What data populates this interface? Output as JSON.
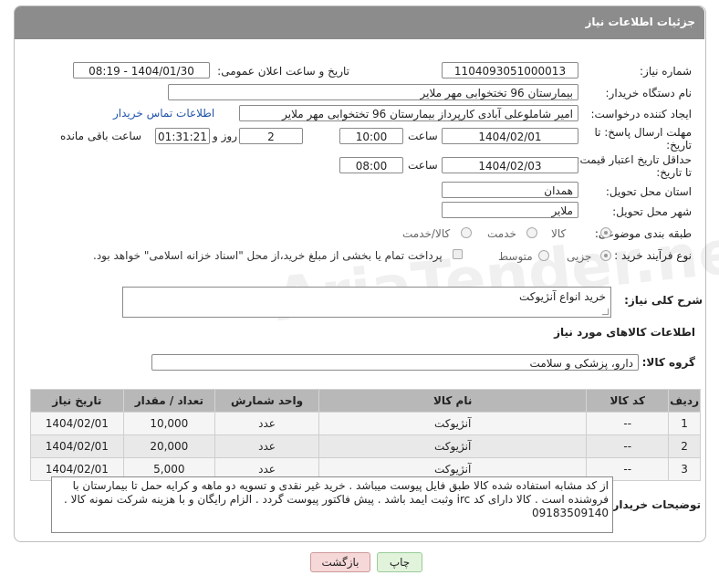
{
  "header": {
    "title": "جزئیات اطلاعات نیاز"
  },
  "form": {
    "need_number": {
      "label": "شماره نیاز:",
      "value": "1104093051000013"
    },
    "announce": {
      "label": "تاریخ و ساعت اعلان عمومی:",
      "value": "1404/01/30 - 08:19"
    },
    "buyer_org": {
      "label": "نام دستگاه خریدار:",
      "value": "بیمارستان 96 تختخوابی مهر ملایر"
    },
    "requester": {
      "label": "ایجاد کننده درخواست:",
      "value": "امیر شاملوعلی آبادی کارپرداز بیمارستان 96 تختخوابی مهر ملایر",
      "contact_link": "اطلاعات تماس خریدار"
    },
    "reply_deadline": {
      "label_line1": "مهلت ارسال پاسخ: تا",
      "label_line2": "تاریخ:",
      "date": "1404/02/01",
      "time_label": "ساعت",
      "time": "10:00",
      "days": "2",
      "days_label": "روز و",
      "remaining": "01:31:21",
      "remaining_label": "ساعت باقی مانده"
    },
    "price_validity": {
      "label_line1": "حداقل تاریخ اعتبار قیمت:",
      "label_line2": "تا تاریخ:",
      "date": "1404/02/03",
      "time_label": "ساعت",
      "time": "08:00"
    },
    "province": {
      "label": "استان محل تحویل:",
      "value": "همدان"
    },
    "city": {
      "label": "شهر محل تحویل:",
      "value": "ملایر"
    },
    "category": {
      "label": "طبقه بندی موضوعی:",
      "options": [
        "کالا",
        "خدمت",
        "کالا/خدمت"
      ],
      "selected": "کالا"
    },
    "process": {
      "label": "نوع فرآیند خرید :",
      "options": [
        "جزیی",
        "متوسط"
      ],
      "payment_note": "پرداخت تمام یا بخشی از مبلغ خرید،از محل \"اسناد خزانه اسلامی\" خواهد بود."
    }
  },
  "summary": {
    "label": "شرح کلی نیاز:",
    "value": "خرید انواع آنژیوکت"
  },
  "goods_section": {
    "title": "اطلاعات کالاهای مورد نیاز"
  },
  "goods_group": {
    "label": "گروه کالا:",
    "value": "دارو، پزشکی و سلامت"
  },
  "table": {
    "headers": [
      "ردیف",
      "کد کالا",
      "نام کالا",
      "واحد شمارش",
      "تعداد / مقدار",
      "تاریخ نیاز"
    ],
    "rows": [
      [
        "1",
        "--",
        "آنژیوکت",
        "عدد",
        "10,000",
        "1404/02/01"
      ],
      [
        "2",
        "--",
        "آنژیوکت",
        "عدد",
        "20,000",
        "1404/02/01"
      ],
      [
        "3",
        "--",
        "آنژیوکت",
        "عدد",
        "5,000",
        "1404/02/01"
      ]
    ]
  },
  "notes": {
    "label": "توضیحات خریدار:",
    "text": "از کد مشابه استفاده شده کالا طبق فایل پیوست  میباشد . خرید غیر نقدی و تسویه دو ماهه و کرایه حمل تا بیمارستان با فروشنده است . کالا دارای کد irc  وثبت ایمد باشد . پیش فاکتور پیوست گردد . الزام رایگان و با هزینه شرکت نمونه کالا . 09183509140"
  },
  "buttons": {
    "print": "چاپ",
    "back": "بازگشت"
  },
  "watermark": "AriaTender.net",
  "colors": {
    "header_bg": "#8c8c8c",
    "link": "#2255aa",
    "back_btn": "#f6d8d8",
    "print_btn": "#e2f3dc"
  }
}
